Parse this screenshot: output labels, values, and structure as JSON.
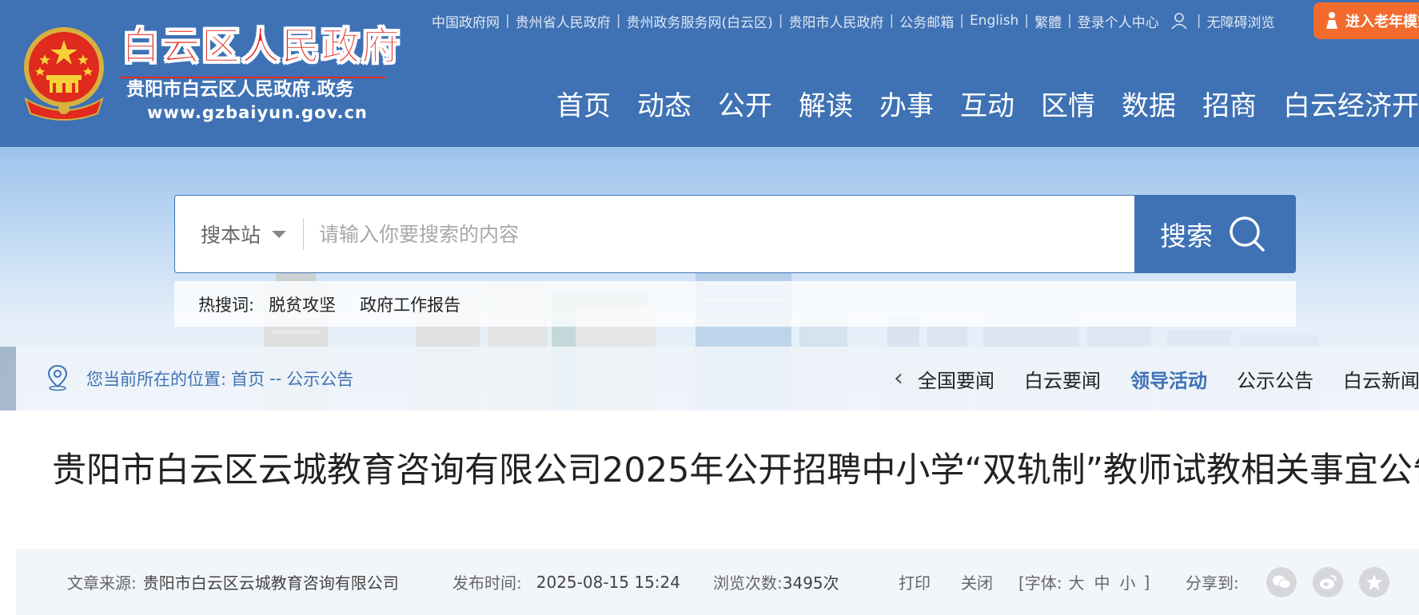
{
  "header": {
    "site_title": "白云区人民政府",
    "site_subtitle": "贵阳市白云区人民政府.政务",
    "site_domain": "www.gzbaiyun.gov.cn",
    "top_links": [
      "中国政府网",
      "贵州省人民政府",
      "贵州政务服务网(白云区)",
      "贵阳市人民政府",
      "公务邮箱",
      "English",
      "繁體",
      "登录个人中心"
    ],
    "accessibility_label": "无障碍浏览",
    "elder_mode_label": "进入老年模式",
    "nav": [
      "首页",
      "动态",
      "公开",
      "解读",
      "办事",
      "互动",
      "区情",
      "数据",
      "招商",
      "白云经济开发区"
    ]
  },
  "search": {
    "scope": "搜本站",
    "placeholder": "请输入你要搜索的内容",
    "button_label": "搜索",
    "hotwords_label": "热搜词:",
    "hotwords": [
      "脱贫攻坚",
      "政府工作报告"
    ]
  },
  "breadcrumb": {
    "prefix": "您当前所在的位置:",
    "home": "首页",
    "separator": "--",
    "current": "公示公告"
  },
  "sub_nav": {
    "items": [
      "全国要闻",
      "白云要闻",
      "领导活动",
      "公示公告",
      "白云新闻"
    ],
    "active": "领导活动"
  },
  "article": {
    "title": "贵阳市白云区云城教育咨询有限公司2025年公开招聘中小学“双轨制”教师试教相关事宜公告",
    "source_label": "文章来源:",
    "source": "贵阳市白云区云城教育咨询有限公司",
    "published_label": "发布时间:",
    "published": "2025-08-15 15:24",
    "views_label": "浏览次数:",
    "views": "3495次",
    "print_label": "打印",
    "close_label": "关闭",
    "font_size_prefix": "[字体:",
    "font_sizes": [
      "大",
      "中",
      "小"
    ],
    "font_size_suffix": "]",
    "share_label": "分享到:",
    "share_icons": [
      "wechat-icon",
      "weibo-icon",
      "qzone-icon"
    ]
  },
  "colors": {
    "primary": "#3f72b4",
    "title_red": "#e32b20",
    "elder_orange": "#f26b2c",
    "meta_bg": "#f2f5f9"
  }
}
